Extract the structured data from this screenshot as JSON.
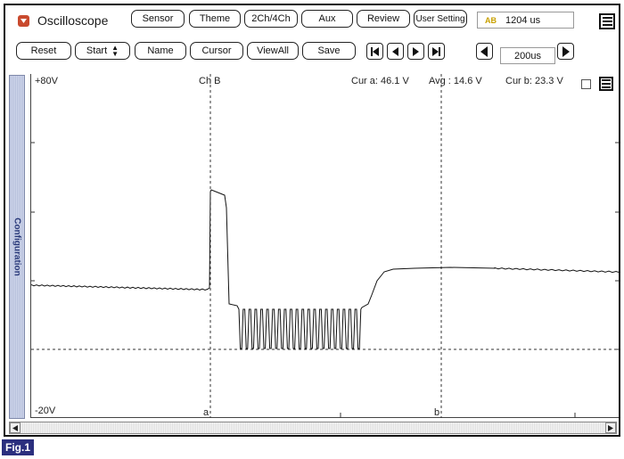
{
  "app": {
    "title": "Oscilloscope"
  },
  "top_menu": [
    "Sensor",
    "Theme",
    "2Ch/4Ch",
    "Aux",
    "Review",
    "User Setting"
  ],
  "readout": "1204 us",
  "readout_icon": "AB",
  "toolbar": {
    "reset": "Reset",
    "start": "Start",
    "name": "Name",
    "cursor": "Cursor",
    "viewall": "ViewAll",
    "save": "Save",
    "timebase": "200us"
  },
  "side_tab": "Configuration",
  "plot": {
    "y_top_label": "+80V",
    "y_bottom_label": "-20V",
    "channel_label": "Ch B",
    "cursor_a_readout": "Cur a: 46.1 V",
    "avg_readout": "Avg : 14.6 V",
    "cursor_b_readout": "Cur b: 23.3 V",
    "cursor_a_label": "a",
    "cursor_b_label": "b"
  },
  "figure_label": "Fig.1",
  "icons": {
    "app": "app-dropdown-icon",
    "menu": "menu-icon",
    "first": "skip-first-icon",
    "prev": "step-back-icon",
    "next": "step-forward-icon",
    "last": "skip-last-icon",
    "timebase_down": "timebase-decrease-icon",
    "timebase_up": "timebase-increase-icon"
  },
  "colors": {
    "accent": "#c94a2e",
    "figure_label_bg": "#2b2f7e",
    "side_tab_text": "#2a3a7a"
  }
}
